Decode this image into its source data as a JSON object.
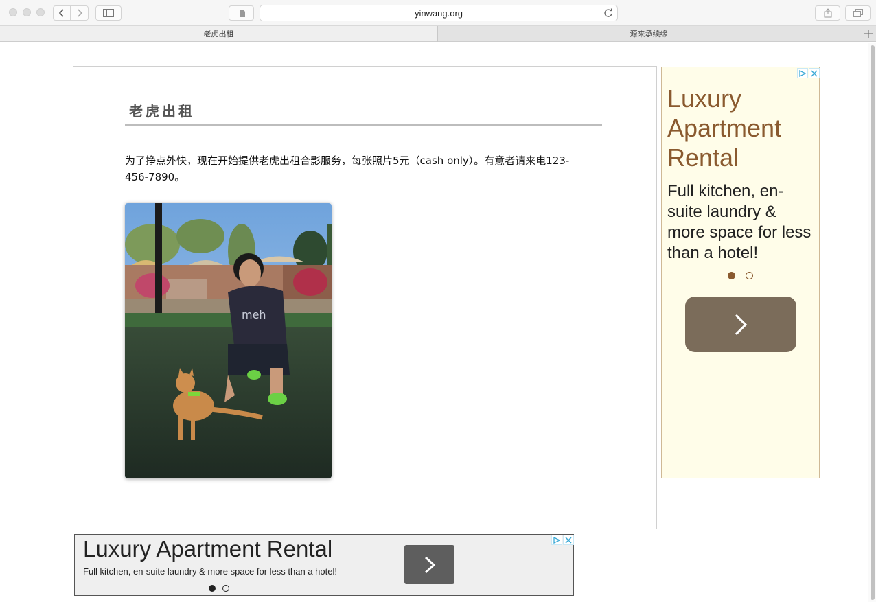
{
  "browser": {
    "url": "yinwang.org",
    "tabs": [
      {
        "label": "老虎出租",
        "active": true
      },
      {
        "label": "源来承续缘",
        "active": false
      }
    ]
  },
  "article": {
    "title": "老虎出租",
    "paragraph": "为了挣点外快，现在开始提供老虎出租合影服务，每张照片5元（cash only）。有意者请来电123-456-7890。",
    "photo_description_icon": "photo-person-with-cat"
  },
  "side_ad": {
    "headline": "Luxury Apartment Rental",
    "body": "Full kitchen, en-suite laundry & more space for less than a hotel!",
    "next_icon": "chevron-right-icon",
    "slide_active": 1,
    "slide_count": 2,
    "colors": {
      "headline": "#8a5a2f",
      "background": "#fffde9",
      "button": "#7b6c5a"
    }
  },
  "bottom_ad": {
    "headline": "Luxury Apartment Rental",
    "body": "Full kitchen, en-suite laundry & more space for less than a hotel!",
    "next_icon": "chevron-right-icon",
    "slide_active": 1,
    "slide_count": 2
  }
}
